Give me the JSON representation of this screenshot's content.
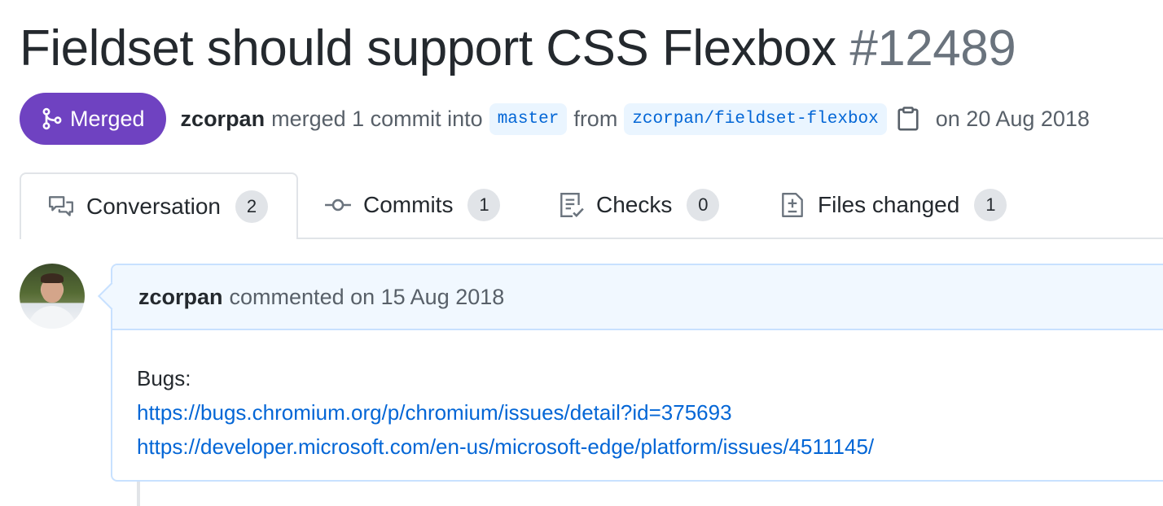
{
  "pr": {
    "title": "Fieldset should support CSS Flexbox",
    "number": "#12489",
    "state_label": "Merged",
    "author": "zcorpan",
    "merge_text": "merged 1 commit into",
    "base_branch": "master",
    "from_text": "from",
    "head_branch": "zcorpan/fieldset-flexbox",
    "merged_date": "on 20 Aug 2018"
  },
  "tabs": [
    {
      "label": "Conversation",
      "count": "2",
      "icon": "comment-discussion-icon",
      "selected": true
    },
    {
      "label": "Commits",
      "count": "1",
      "icon": "git-commit-icon",
      "selected": false
    },
    {
      "label": "Checks",
      "count": "0",
      "icon": "checklist-icon",
      "selected": false
    },
    {
      "label": "Files changed",
      "count": "1",
      "icon": "file-diff-icon",
      "selected": false
    }
  ],
  "comment": {
    "author": "zcorpan",
    "meta": "commented on 15 Aug 2018",
    "body_heading": "Bugs:",
    "links": [
      "https://bugs.chromium.org/p/chromium/issues/detail?id=375693",
      "https://developer.microsoft.com/en-us/microsoft-edge/platform/issues/4511145/"
    ]
  },
  "colors": {
    "merged": "#6f42c1",
    "link": "#0366d6",
    "comment_header_bg": "#f1f8ff",
    "comment_border": "#c8e1ff"
  }
}
